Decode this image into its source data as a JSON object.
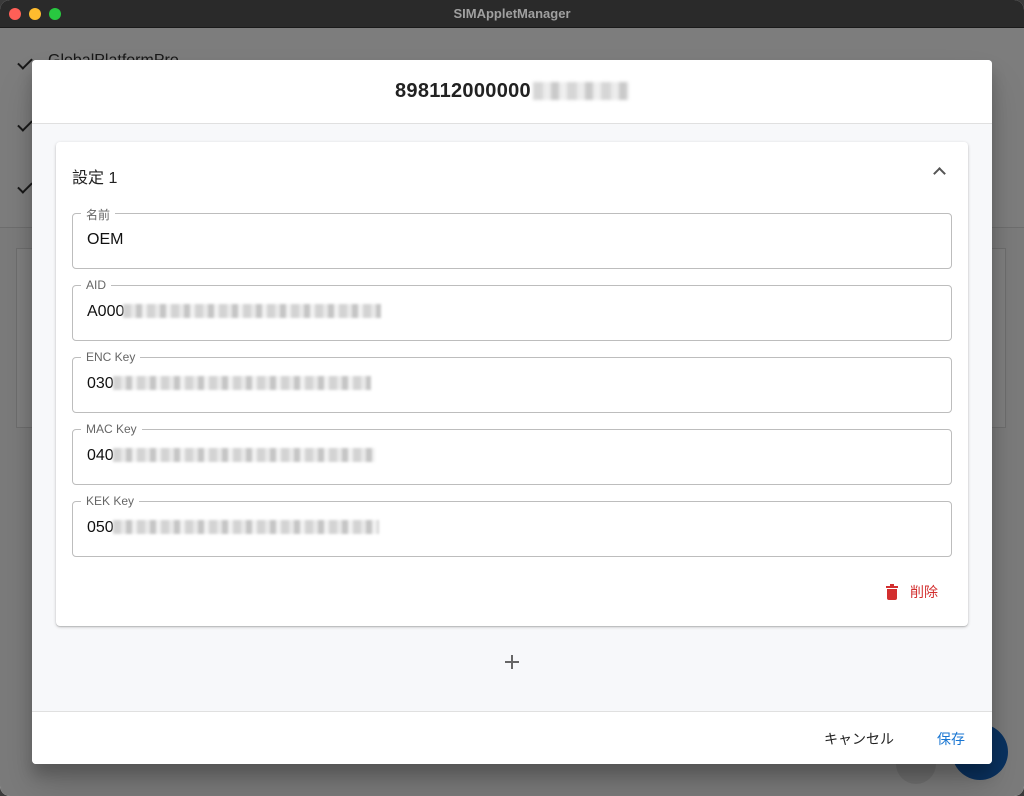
{
  "window": {
    "title": "SIMAppletManager"
  },
  "background": {
    "first_row_text": "GlobalPlatformPro"
  },
  "dialog": {
    "title": "898112000000",
    "panel": {
      "title": "設定 1",
      "fields": [
        {
          "label": "名前",
          "value": "OEM"
        },
        {
          "label": "AID",
          "value": "A000"
        },
        {
          "label": "ENC Key",
          "value": "030"
        },
        {
          "label": "MAC Key",
          "value": "040"
        },
        {
          "label": "KEK Key",
          "value": "050"
        }
      ],
      "delete_label": "削除"
    },
    "footer": {
      "cancel_label": "キャンセル",
      "save_label": "保存"
    }
  },
  "icons": {
    "collapse": "chevron-up-icon",
    "delete": "trash-icon",
    "add": "plus-icon"
  },
  "colors": {
    "delete": "#d32f2f",
    "primary": "#1976d2"
  }
}
